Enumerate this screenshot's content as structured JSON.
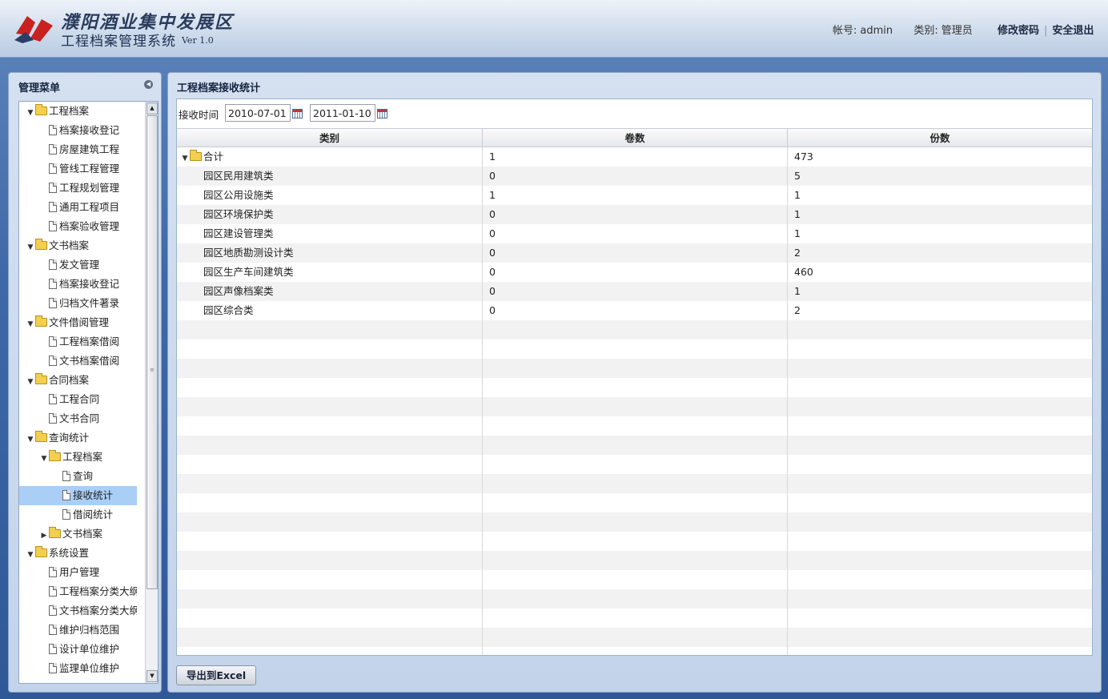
{
  "header": {
    "brand_top": "濮阳酒业集中发展区",
    "brand_main": "工程档案管理系统",
    "version": "Ver 1.0",
    "account_label": "帐号:",
    "account_value": "admin",
    "role_label": "类别:",
    "role_value": "管理员",
    "change_password": "修改密码",
    "separator": "|",
    "logout": "安全退出"
  },
  "sidebar": {
    "title": "管理菜单",
    "items": [
      {
        "label": "工程档案",
        "type": "folder",
        "level": 0,
        "expanded": true
      },
      {
        "label": "档案接收登记",
        "type": "doc",
        "level": 1
      },
      {
        "label": "房屋建筑工程",
        "type": "doc",
        "level": 1
      },
      {
        "label": "管线工程管理",
        "type": "doc",
        "level": 1
      },
      {
        "label": "工程规划管理",
        "type": "doc",
        "level": 1
      },
      {
        "label": "通用工程项目",
        "type": "doc",
        "level": 1
      },
      {
        "label": "档案验收管理",
        "type": "doc",
        "level": 1
      },
      {
        "label": "文书档案",
        "type": "folder",
        "level": 0,
        "expanded": true
      },
      {
        "label": "发文管理",
        "type": "doc",
        "level": 1
      },
      {
        "label": "档案接收登记",
        "type": "doc",
        "level": 1
      },
      {
        "label": "归档文件著录",
        "type": "doc",
        "level": 1
      },
      {
        "label": "文件借阅管理",
        "type": "folder",
        "level": 0,
        "expanded": true
      },
      {
        "label": "工程档案借阅",
        "type": "doc",
        "level": 1
      },
      {
        "label": "文书档案借阅",
        "type": "doc",
        "level": 1
      },
      {
        "label": "合同档案",
        "type": "folder",
        "level": 0,
        "expanded": true
      },
      {
        "label": "工程合同",
        "type": "doc",
        "level": 1
      },
      {
        "label": "文书合同",
        "type": "doc",
        "level": 1
      },
      {
        "label": "查询统计",
        "type": "folder",
        "level": 0,
        "expanded": true
      },
      {
        "label": "工程档案",
        "type": "folder",
        "level": 1,
        "expanded": true
      },
      {
        "label": "查询",
        "type": "doc",
        "level": 2
      },
      {
        "label": "接收统计",
        "type": "doc",
        "level": 2,
        "selected": true
      },
      {
        "label": "借阅统计",
        "type": "doc",
        "level": 2
      },
      {
        "label": "文书档案",
        "type": "folder",
        "level": 1,
        "expanded": false
      },
      {
        "label": "系统设置",
        "type": "folder",
        "level": 0,
        "expanded": true
      },
      {
        "label": "用户管理",
        "type": "doc",
        "level": 1
      },
      {
        "label": "工程档案分类大纲",
        "type": "doc",
        "level": 1
      },
      {
        "label": "文书档案分类大纲",
        "type": "doc",
        "level": 1
      },
      {
        "label": "维护归档范围",
        "type": "doc",
        "level": 1
      },
      {
        "label": "设计单位维护",
        "type": "doc",
        "level": 1
      },
      {
        "label": "监理单位维护",
        "type": "doc",
        "level": 1
      }
    ]
  },
  "main": {
    "title": "工程档案接收统计",
    "filter_label": "接收时间",
    "date_from": "2010-07-01",
    "date_to": "2011-01-10",
    "columns": [
      "类别",
      "卷数",
      "份数"
    ],
    "total_row": {
      "category": "合计",
      "volumes": "1",
      "copies": "473"
    },
    "rows": [
      {
        "category": "园区民用建筑类",
        "volumes": "0",
        "copies": "5"
      },
      {
        "category": "园区公用设施类",
        "volumes": "1",
        "copies": "1"
      },
      {
        "category": "园区环境保护类",
        "volumes": "0",
        "copies": "1"
      },
      {
        "category": "园区建设管理类",
        "volumes": "0",
        "copies": "1"
      },
      {
        "category": "园区地质勘测设计类",
        "volumes": "0",
        "copies": "2"
      },
      {
        "category": "园区生产车间建筑类",
        "volumes": "0",
        "copies": "460"
      },
      {
        "category": "园区声像档案类",
        "volumes": "0",
        "copies": "1"
      },
      {
        "category": "园区综合类",
        "volumes": "0",
        "copies": "2"
      }
    ],
    "export_label": "导出到Excel"
  },
  "icons": {
    "expanded": "▼",
    "collapsed": "▶",
    "collapse_panel": "◀",
    "scroll_up": "▲",
    "scroll_down": "▼"
  },
  "colors": {
    "selected_row": "#a9cff7",
    "panel_bg": "#c9d8ec",
    "accent_blue": "#3f68a6"
  }
}
